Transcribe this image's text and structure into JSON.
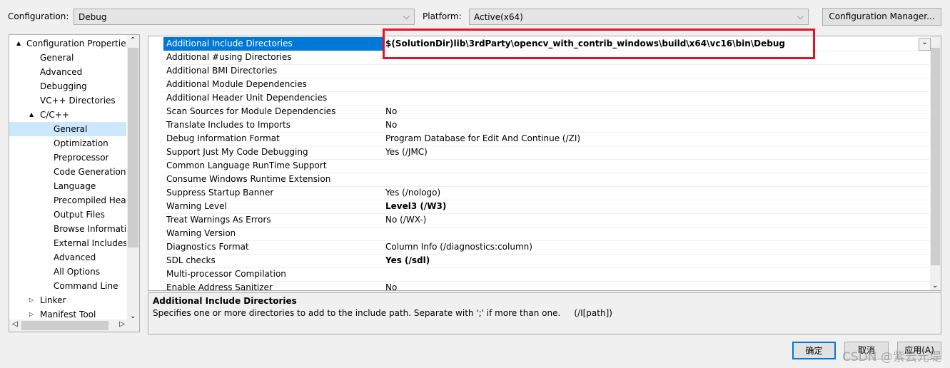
{
  "top": {
    "config_label": "Configuration:",
    "config_value": "Debug",
    "platform_label": "Platform:",
    "platform_value": "Active(x64)",
    "manager_button": "Configuration Manager..."
  },
  "tree": [
    {
      "label": "Configuration Properties",
      "level": 0,
      "exp": "▲"
    },
    {
      "label": "General",
      "level": 1
    },
    {
      "label": "Advanced",
      "level": 1
    },
    {
      "label": "Debugging",
      "level": 1
    },
    {
      "label": "VC++ Directories",
      "level": 1
    },
    {
      "label": "C/C++",
      "level": 1,
      "exp": "▲"
    },
    {
      "label": "General",
      "level": 2,
      "selected": true
    },
    {
      "label": "Optimization",
      "level": 2
    },
    {
      "label": "Preprocessor",
      "level": 2
    },
    {
      "label": "Code Generation",
      "level": 2
    },
    {
      "label": "Language",
      "level": 2
    },
    {
      "label": "Precompiled Headers",
      "level": 2
    },
    {
      "label": "Output Files",
      "level": 2
    },
    {
      "label": "Browse Information",
      "level": 2
    },
    {
      "label": "External Includes",
      "level": 2
    },
    {
      "label": "Advanced",
      "level": 2
    },
    {
      "label": "All Options",
      "level": 2
    },
    {
      "label": "Command Line",
      "level": 2
    },
    {
      "label": "Linker",
      "level": 1,
      "exp": "▷"
    },
    {
      "label": "Manifest Tool",
      "level": 1,
      "exp": "▷"
    }
  ],
  "grid": [
    {
      "name": "Additional Include Directories",
      "value": "$(SolutionDir)lib\\3rdParty\\opencv_with_contrib_windows\\build\\x64\\vc16\\bin\\Debug",
      "bold": true,
      "selected": true
    },
    {
      "name": "Additional #using Directories",
      "value": ""
    },
    {
      "name": "Additional BMI Directories",
      "value": ""
    },
    {
      "name": "Additional Module Dependencies",
      "value": ""
    },
    {
      "name": "Additional Header Unit Dependencies",
      "value": ""
    },
    {
      "name": "Scan Sources for Module Dependencies",
      "value": "No"
    },
    {
      "name": "Translate Includes to Imports",
      "value": "No"
    },
    {
      "name": "Debug Information Format",
      "value": "Program Database for Edit And Continue (/ZI)"
    },
    {
      "name": "Support Just My Code Debugging",
      "value": "Yes (/JMC)"
    },
    {
      "name": "Common Language RunTime Support",
      "value": ""
    },
    {
      "name": "Consume Windows Runtime Extension",
      "value": ""
    },
    {
      "name": "Suppress Startup Banner",
      "value": "Yes (/nologo)"
    },
    {
      "name": "Warning Level",
      "value": "Level3 (/W3)",
      "bold": true
    },
    {
      "name": "Treat Warnings As Errors",
      "value": "No (/WX-)"
    },
    {
      "name": "Warning Version",
      "value": ""
    },
    {
      "name": "Diagnostics Format",
      "value": "Column Info (/diagnostics:column)"
    },
    {
      "name": "SDL checks",
      "value": "Yes (/sdl)",
      "bold": true
    },
    {
      "name": "Multi-processor Compilation",
      "value": ""
    },
    {
      "name": "Enable Address Sanitizer",
      "value": "No"
    }
  ],
  "desc": {
    "title": "Additional Include Directories",
    "text": "Specifies one or more directories to add to the include path. Separate with ';' if more than one.     (/I[path])"
  },
  "buttons": {
    "ok": "确定",
    "cancel": "取消",
    "apply": "应用(A)"
  },
  "watermark": "CSDN @紫云元堤",
  "highlight_color": "#e81123"
}
